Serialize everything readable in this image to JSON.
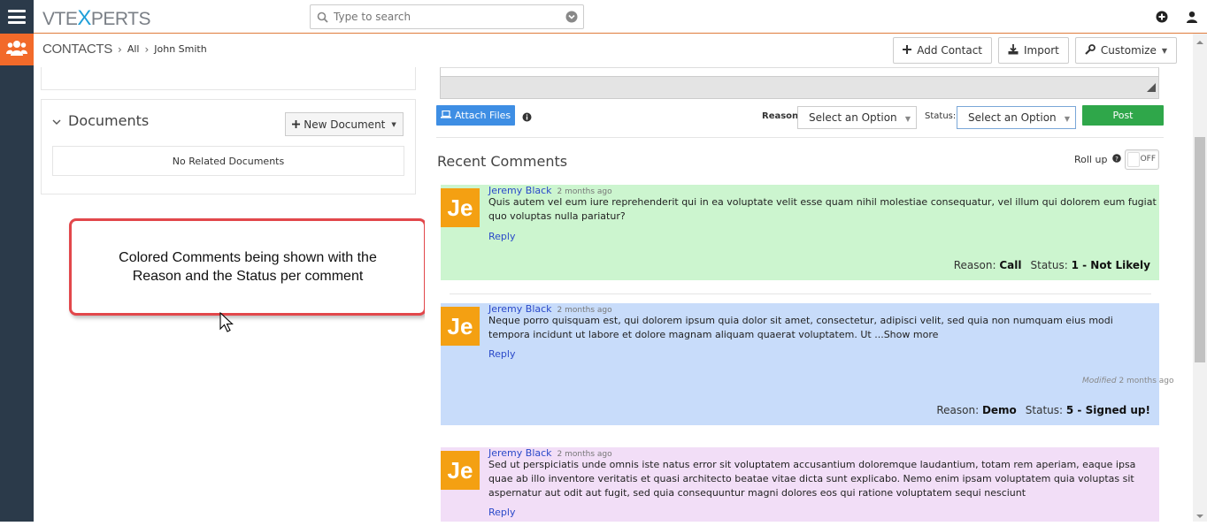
{
  "header": {
    "logo_part1": "VTE",
    "logo_part2": "X",
    "logo_part3": "PERTS",
    "search_placeholder": "Type to search",
    "icons": [
      "menu-icon",
      "search-icon",
      "chevron-down-circle-icon",
      "plus-circle-icon",
      "user-icon"
    ]
  },
  "breadcrumb": {
    "module": "CONTACTS",
    "filter": "All",
    "record": "John Smith"
  },
  "actions": {
    "add_contact": "Add Contact",
    "import": "Import",
    "customize": "Customize"
  },
  "documents": {
    "title": "Documents",
    "new_document": "New Document",
    "empty": "No Related Documents"
  },
  "callout": {
    "text": "Colored Comments being shown with the Reason and the Status per comment"
  },
  "composer": {
    "attach_files": "Attach Files",
    "reason_label": "Reason:",
    "reason_value": "Select an Option",
    "status_label": "Status:",
    "status_value": "Select an Option",
    "post": "Post"
  },
  "recent": {
    "title": "Recent Comments",
    "rollup_label": "Roll up",
    "rollup_state": "OFF"
  },
  "comments": [
    {
      "initials": "Je",
      "author": "Jeremy Black",
      "when": "2 months ago",
      "text": "Quis autem vel eum iure reprehenderit qui in ea voluptate velit esse quam nihil molestiae consequatur, vel illum qui dolorem eum fugiat quo voluptas nulla pariatur?",
      "reply": "Reply",
      "reason_label": "Reason:",
      "reason": "Call",
      "status_label": "Status:",
      "status": "1 - Not Likely",
      "bg": "#ccf5cf"
    },
    {
      "initials": "Je",
      "author": "Jeremy Black",
      "when": "2 months ago",
      "text": "Neque porro quisquam est, qui dolorem ipsum quia dolor sit amet, consectetur, adipisci velit, sed quia non numquam eius modi tempora incidunt ut labore et dolore magnam aliquam quaerat voluptatem. Ut ...Show more",
      "reply": "Reply",
      "modified_label": "Modified",
      "modified_when": "2 months ago",
      "reason_label": "Reason:",
      "reason": "Demo",
      "status_label": "Status:",
      "status": "5 - Signed up!",
      "bg": "#c8dcfa"
    },
    {
      "initials": "Je",
      "author": "Jeremy Black",
      "when": "2 months ago",
      "text": "Sed ut perspiciatis unde omnis iste natus error sit voluptatem accusantium doloremque laudantium, totam rem aperiam, eaque ipsa quae ab illo inventore veritatis et quasi architecto beatae vitae dicta sunt explicabo. Nemo enim ipsam voluptatem quia voluptas sit aspernatur aut odit aut fugit, sed quia consequuntur magni dolores eos qui ratione voluptatem sequi nesciunt",
      "reply": "Reply",
      "bg": "#f2def7"
    }
  ],
  "colors": {
    "accent_orange": "#f26a2a",
    "nav_dark": "#2b3a4a",
    "attach_blue": "#3e8ee4",
    "post_green": "#2fa74a",
    "avatar_orange": "#f4a012",
    "callout_border": "#e2474b"
  }
}
